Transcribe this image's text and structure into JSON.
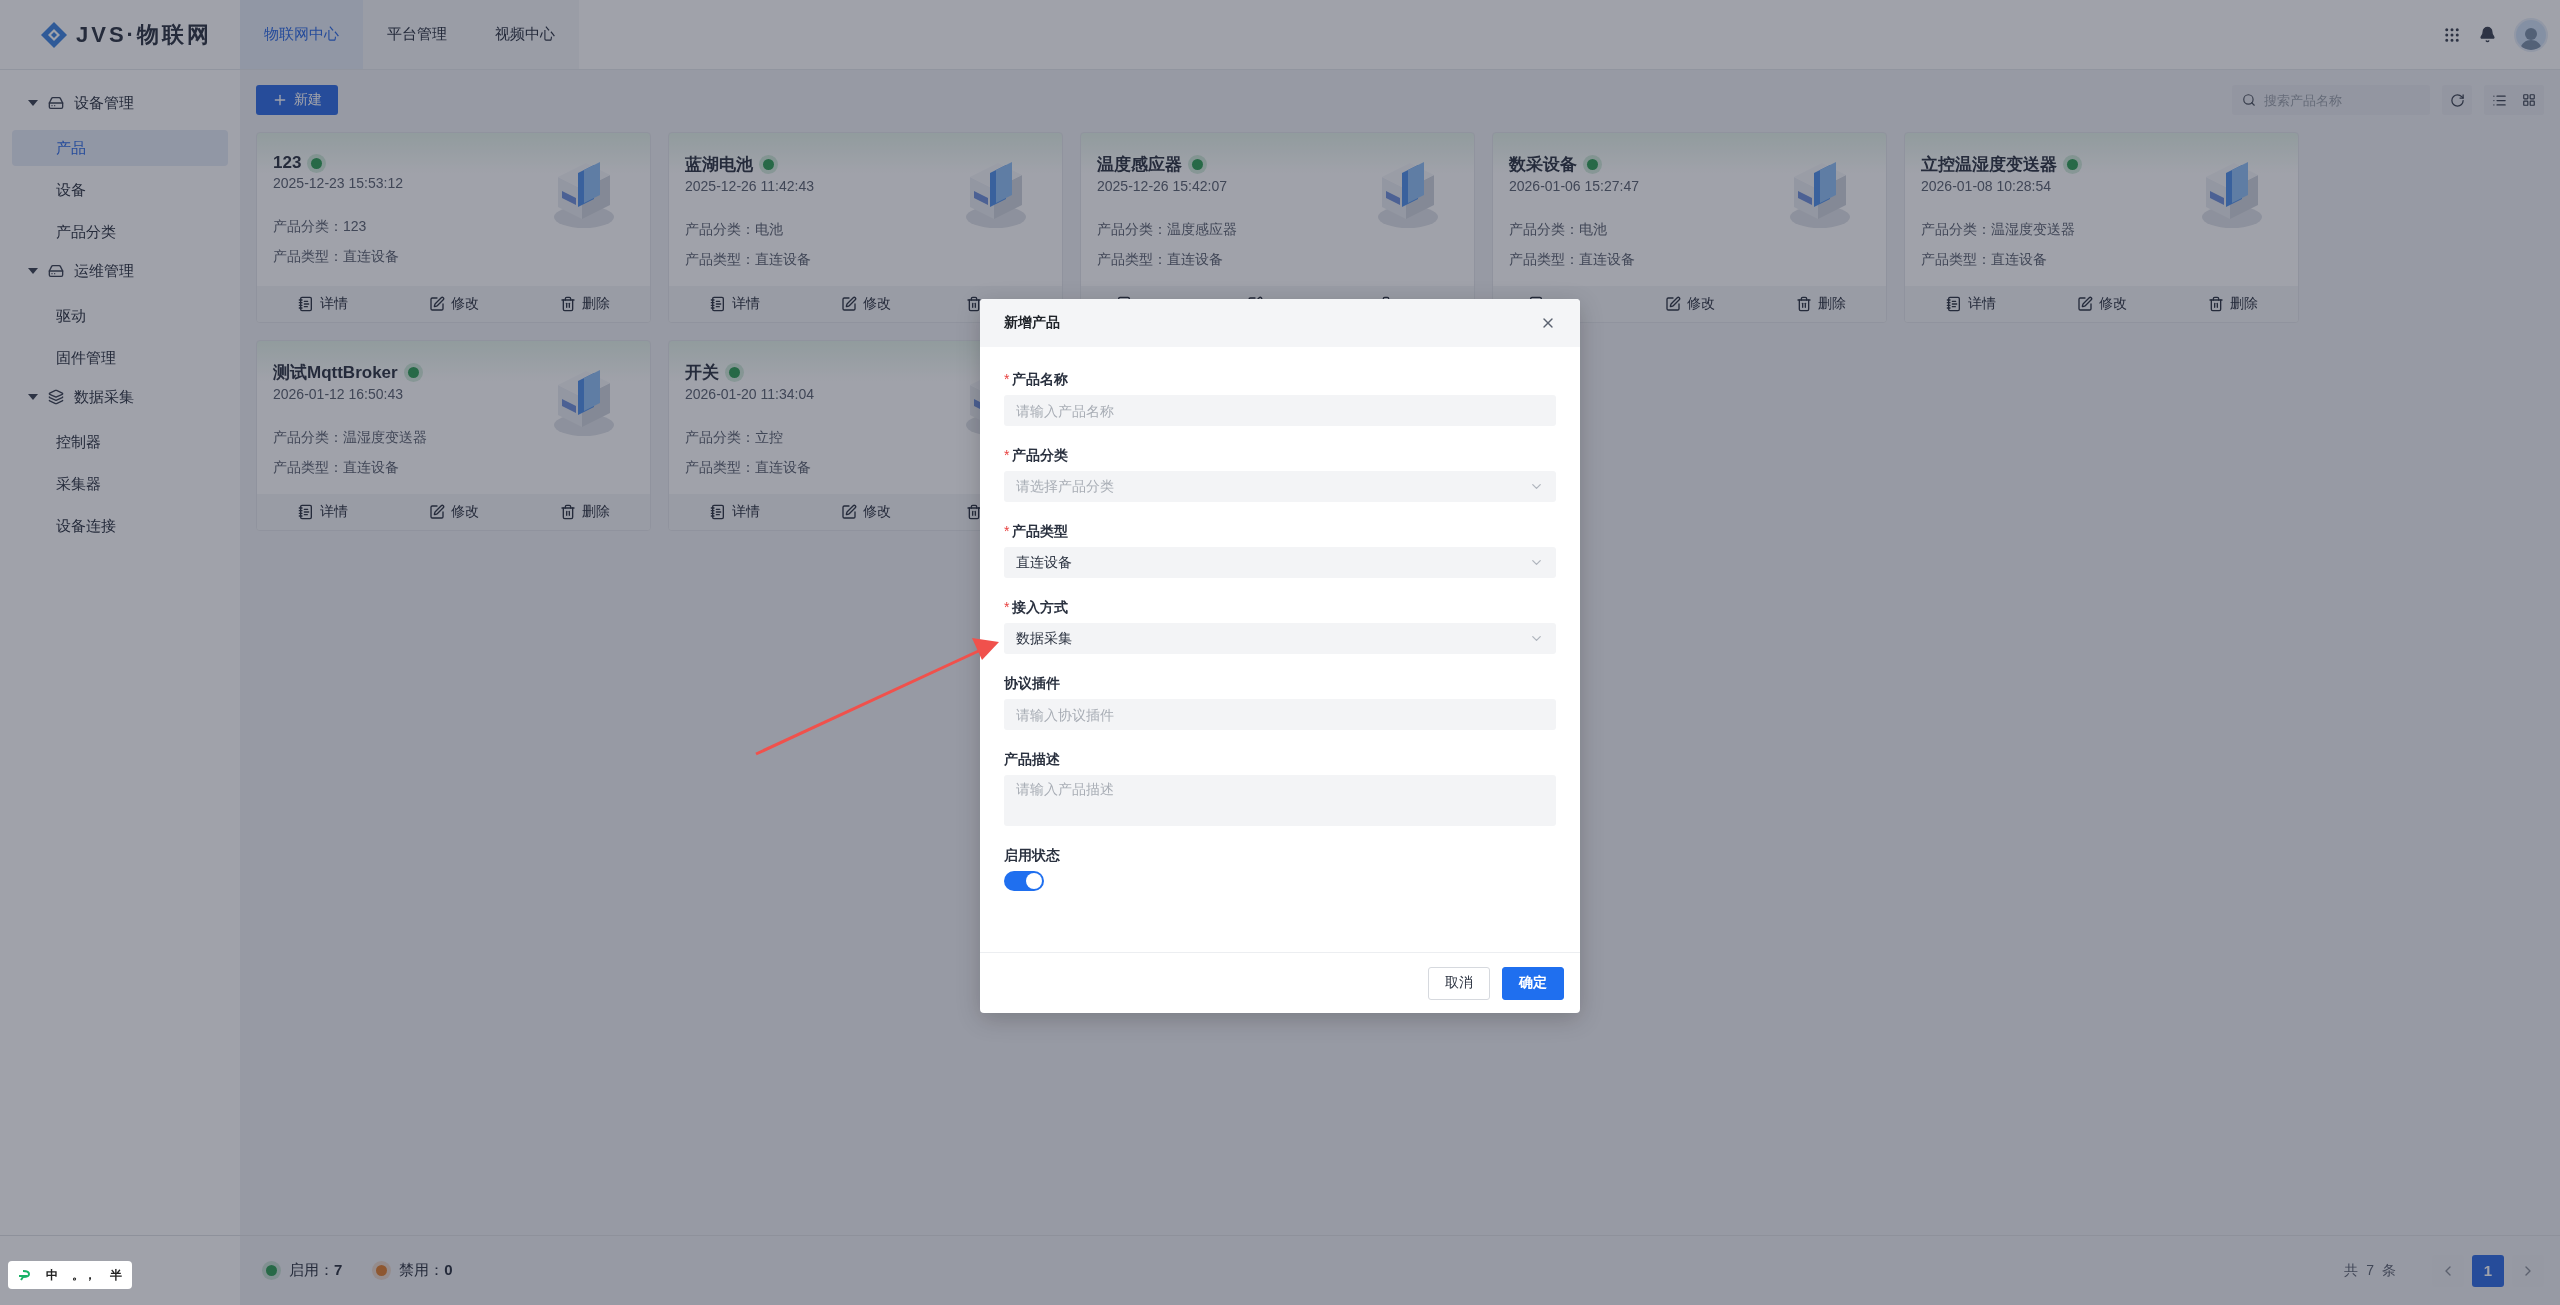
{
  "header": {
    "logo": "JVS·物联网",
    "tabs": [
      {
        "label": "物联网中心",
        "selected": true
      },
      {
        "label": "平台管理",
        "selected": false
      },
      {
        "label": "视频中心",
        "selected": false
      }
    ]
  },
  "sidebar": {
    "groups": [
      {
        "label": "设备管理",
        "kind": "device",
        "expanded": true,
        "children": [
          {
            "label": "产品",
            "selected": true
          },
          {
            "label": "设备",
            "selected": false
          },
          {
            "label": "产品分类",
            "selected": false
          }
        ]
      },
      {
        "label": "运维管理",
        "kind": "device",
        "expanded": true,
        "children": [
          {
            "label": "驱动",
            "selected": false
          },
          {
            "label": "固件管理",
            "selected": false
          }
        ]
      },
      {
        "label": "数据采集",
        "kind": "collect",
        "expanded": true,
        "children": [
          {
            "label": "控制器",
            "selected": false
          },
          {
            "label": "采集器",
            "selected": false
          },
          {
            "label": "设备连接",
            "selected": false
          }
        ]
      }
    ]
  },
  "toolbar": {
    "new_button": "新建",
    "search": {
      "placeholder": "搜索产品名称"
    }
  },
  "products": [
    {
      "name": "123",
      "enabled": true,
      "time": "2025-12-23 15:53:12",
      "category": "产品分类：123",
      "type": "产品类型：直连设备",
      "actions": [
        {
          "kind": "detail",
          "label": "详情"
        },
        {
          "kind": "edit",
          "label": "修改"
        },
        {
          "kind": "delete",
          "label": "删除"
        }
      ]
    },
    {
      "name": "蓝湖电池",
      "enabled": true,
      "time": "2025-12-26 11:42:43",
      "category": "产品分类：电池",
      "type": "产品类型：直连设备",
      "actions": [
        {
          "kind": "detail",
          "label": "详情"
        },
        {
          "kind": "edit",
          "label": "修改"
        },
        {
          "kind": "delete"
        }
      ]
    },
    {
      "name": "温度感应器",
      "enabled": true,
      "time": "2025-12-26 15:42:07",
      "category": "产品分类：温度感应器",
      "type": "产品类型：直连设备",
      "actions": [
        {
          "kind": "detail"
        },
        {
          "kind": "edit"
        },
        {
          "kind": "delete"
        }
      ]
    },
    {
      "name": "数采设备",
      "enabled": true,
      "time": "2026-01-06 15:27:47",
      "category": "产品分类：电池",
      "type": "产品类型：直连设备",
      "actions": [
        {
          "kind": "detail"
        },
        {
          "kind": "edit",
          "label": "修改"
        },
        {
          "kind": "delete",
          "label": "删除"
        }
      ]
    },
    {
      "name": "立控温湿度变送器",
      "enabled": true,
      "time": "2026-01-08 10:28:54",
      "category": "产品分类：温湿度变送器",
      "type": "产品类型：直连设备",
      "actions": [
        {
          "kind": "detail",
          "label": "详情"
        },
        {
          "kind": "edit",
          "label": "修改"
        },
        {
          "kind": "delete",
          "label": "删除"
        }
      ]
    },
    {
      "name": "测试MqttBroker",
      "enabled": true,
      "time": "2026-01-12 16:50:43",
      "category": "产品分类：温湿度变送器",
      "type": "产品类型：直连设备",
      "actions": [
        {
          "kind": "detail",
          "label": "详情"
        },
        {
          "kind": "edit",
          "label": "修改"
        },
        {
          "kind": "delete",
          "label": "删除"
        }
      ]
    },
    {
      "name": "开关",
      "enabled": true,
      "time": "2026-01-20 11:34:04",
      "category": "产品分类：立控",
      "type": "产品类型：直连设备",
      "actions": [
        {
          "kind": "detail",
          "label": "详情"
        },
        {
          "kind": "edit",
          "label": "修改"
        },
        {
          "kind": "delete"
        }
      ]
    }
  ],
  "footer": {
    "legend": [
      {
        "label": "启用：**7**",
        "kind": "enabled"
      },
      {
        "label": "禁用：**0**",
        "kind": "disabled"
      }
    ],
    "total": "共 7 条",
    "pages": [
      {
        "label": "1",
        "selected": true
      }
    ]
  },
  "ime_bar": {
    "keys": [
      "中",
      "。，",
      "半"
    ]
  },
  "dialog": {
    "title": "新增产品",
    "fields": [
      {
        "kind": "input",
        "mark": "*",
        "label": "产品名称",
        "placeholder": "请输入产品名称"
      },
      {
        "kind": "select",
        "mark": "*",
        "label": "产品分类",
        "placeholder": "请选择产品分类"
      },
      {
        "kind": "select",
        "mark": "*",
        "label": "产品类型",
        "value": "直连设备"
      },
      {
        "kind": "select",
        "mark": "*",
        "label": "接入方式",
        "value": "数据采集"
      },
      {
        "kind": "input",
        "label": "协议插件",
        "placeholder": "请输入协议插件"
      },
      {
        "kind": "textarea",
        "label": "产品描述",
        "placeholder": "请输入产品描述"
      },
      {
        "kind": "switch",
        "label": "启用状态",
        "on": true
      }
    ],
    "buttons": [
      {
        "kind": "secondary",
        "label": "取消"
      },
      {
        "kind": "primary",
        "label": "确定"
      }
    ]
  }
}
